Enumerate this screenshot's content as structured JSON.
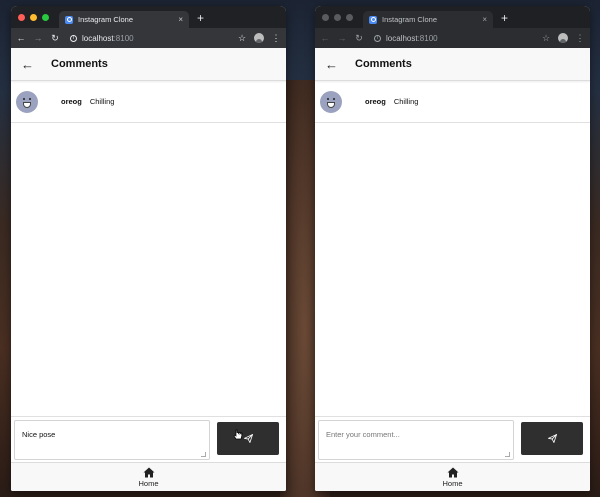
{
  "windows": [
    {
      "tab_title": "Instagram Clone",
      "tab_close": "×",
      "new_tab": "+",
      "url_host": "localhost",
      "url_port": ":8100",
      "page_title": "Comments",
      "comments": [
        {
          "user": "oreog",
          "text": "Chilling"
        }
      ],
      "compose_value": "Nice pose",
      "compose_placeholder": "Enter your comment...",
      "home_label": "Home",
      "traffic_colors": [
        "#ff5f57",
        "#febc2e",
        "#28c840"
      ]
    },
    {
      "tab_title": "Instagram Clone",
      "tab_close": "×",
      "new_tab": "+",
      "url_host": "localhost",
      "url_port": ":8100",
      "page_title": "Comments",
      "comments": [
        {
          "user": "oreog",
          "text": "Chilling"
        }
      ],
      "compose_value": "",
      "compose_placeholder": "Enter your comment...",
      "home_label": "Home",
      "traffic_colors": [
        "#5a5b5e",
        "#5a5b5e",
        "#5a5b5e"
      ]
    }
  ],
  "icons": {
    "back": "arrow-left-icon",
    "send": "paper-plane-icon",
    "home": "home-icon",
    "reload": "reload-icon",
    "star": "star-icon"
  },
  "colors": {
    "send_button": "#2f2f2f",
    "avatar_bg": "#9aa2bf"
  }
}
